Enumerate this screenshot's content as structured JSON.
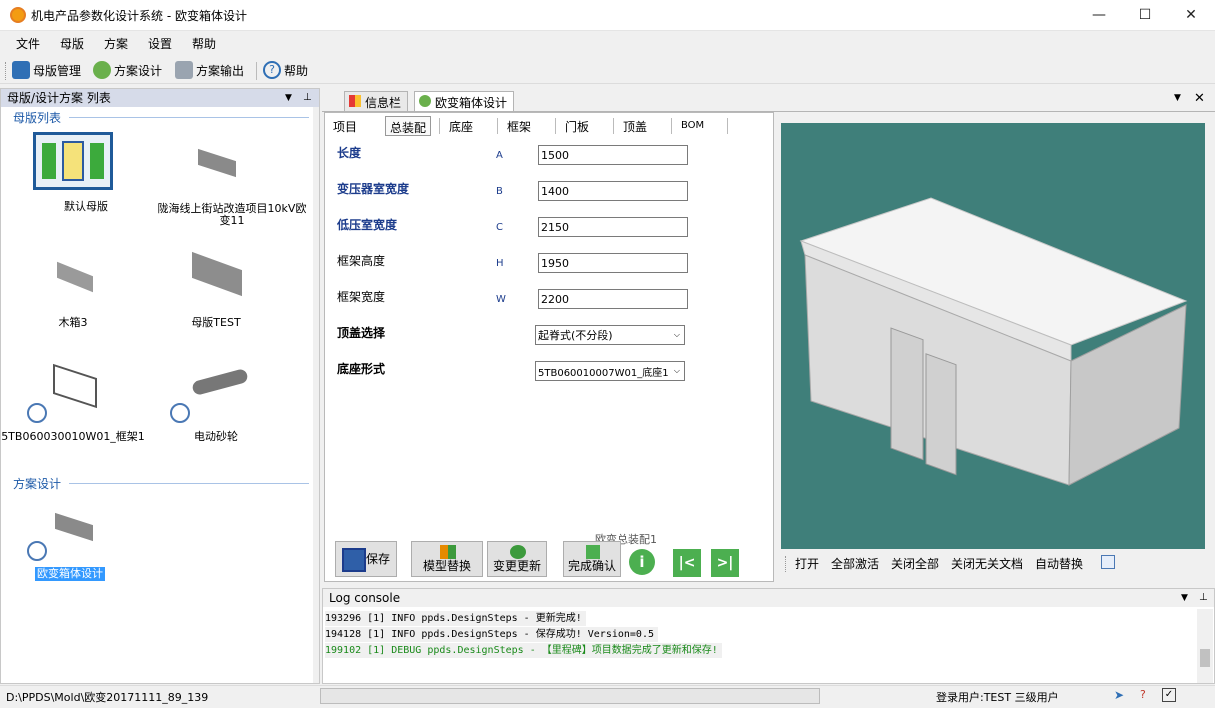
{
  "window": {
    "title": "机电产品参数化设计系统 - 欧变箱体设计"
  },
  "menu": [
    "文件",
    "母版",
    "方案",
    "设置",
    "帮助"
  ],
  "toolbar": {
    "master": "母版管理",
    "design": "方案设计",
    "output": "方案输出",
    "help": "帮助"
  },
  "left_panel": {
    "title": "母版/设计方案 列表",
    "group_masters": "母版列表",
    "masters": [
      {
        "label": "默认母版"
      },
      {
        "label": "陇海线上街站改造项目10kV欧变11"
      },
      {
        "label": "木箱3"
      },
      {
        "label": "母版TEST"
      },
      {
        "label": "5TB060030010W01_框架1"
      },
      {
        "label": "电动砂轮"
      }
    ],
    "group_designs": "方案设计",
    "designs": [
      {
        "label": "欧变箱体设计"
      }
    ]
  },
  "doc_tabs": [
    {
      "label": "信息栏"
    },
    {
      "label": "欧变箱体设计"
    }
  ],
  "sub_tabs": [
    "项目",
    "总装配",
    "底座",
    "框架",
    "门板",
    "顶盖",
    "BOM"
  ],
  "form": {
    "fields": [
      {
        "label": "长度",
        "key": "A",
        "value": "1500"
      },
      {
        "label": "变压器室宽度",
        "key": "B",
        "value": "1400"
      },
      {
        "label": "低压室宽度",
        "key": "C",
        "value": "2150"
      },
      {
        "label": "框架高度",
        "key": "H",
        "value": "1950"
      },
      {
        "label": "框架宽度",
        "key": "W",
        "value": "2200"
      }
    ],
    "roof_label": "顶盖选择",
    "roof_value": "起脊式(不分段)",
    "base_label": "底座形式",
    "base_value": "5TB060010007W01_底座1",
    "asm_caption": "欧变总装配1",
    "buttons": {
      "save": "保存",
      "replace": "模型替换",
      "update": "变更更新",
      "confirm": "完成确认"
    }
  },
  "viewer_toolbar": [
    "打开",
    "全部激活",
    "关闭全部",
    "关闭无关文档",
    "自动替换"
  ],
  "console": {
    "title": "Log console",
    "lines": [
      "193296 [1] INFO  ppds.DesignSteps - 更新完成!",
      "194128 [1] INFO  ppds.DesignSteps - 保存成功! Version=0.5",
      "199102 [1] DEBUG ppds.DesignSteps - 【里程碑】项目数据完成了更新和保存!"
    ]
  },
  "status": {
    "path": "D:\\PPDS\\Mold\\欧变20171111_89_139",
    "user": "登录用户:TEST  三级用户"
  },
  "colors": {
    "viewport": "#3f7f7a",
    "debug": "#1a8a1a",
    "accent": "#1e5aa8"
  }
}
